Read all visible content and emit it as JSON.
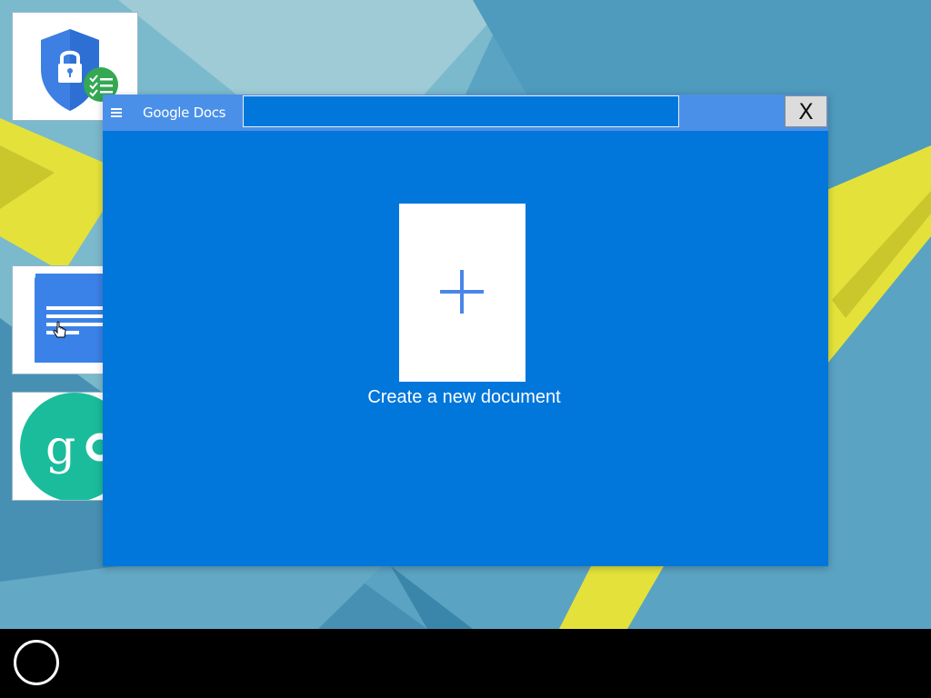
{
  "window": {
    "title": "Google Docs",
    "search_value": "",
    "close_label": "X",
    "new_document_label": "Create a new document"
  },
  "desktop_apps": [
    {
      "name": "security-checklist",
      "icon": "shield-lock-checklist-icon"
    },
    {
      "name": "google-docs",
      "icon": "document-icon"
    },
    {
      "name": "google-settings",
      "icon": "google-settings-icon"
    }
  ],
  "colors": {
    "window_bg": "#0176db",
    "titlebar_bg": "#4a90e8",
    "wallpaper": "#5aa3c2",
    "accent_yellow": "#e4e23a",
    "taskbar": "#000000"
  }
}
